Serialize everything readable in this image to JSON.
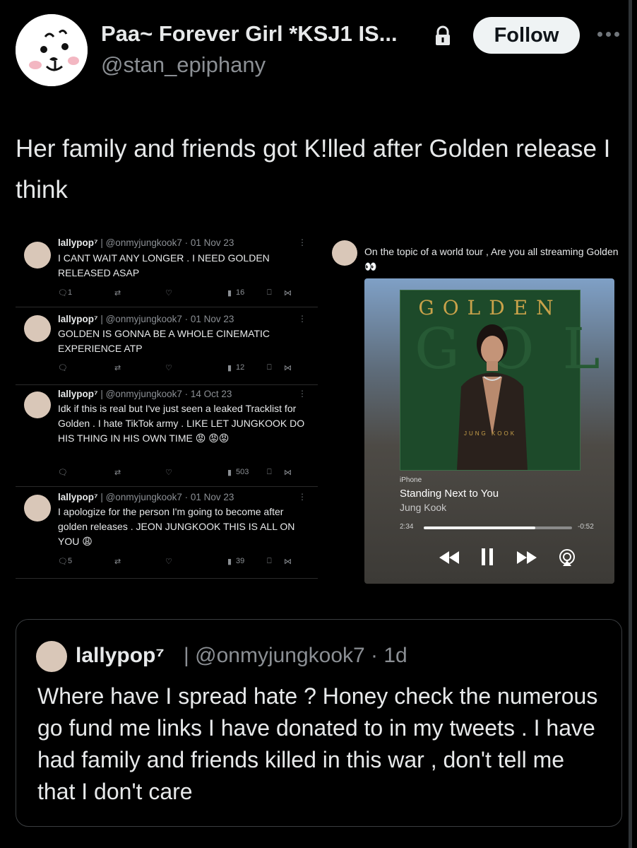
{
  "header": {
    "display_name": "Paa~ Forever Girl *KSJ1 IS...",
    "handle": "@stan_epiphany",
    "follow_label": "Follow"
  },
  "tweet": {
    "text": "Her family and friends got K!lled after Golden release I think"
  },
  "left_image": {
    "tweets": [
      {
        "name": "lallypop⁷",
        "handle": "| @onmyjungkook7 · 01 Nov 23",
        "body": "I CANT WAIT ANY LONGER . I NEED GOLDEN RELEASED ASAP",
        "replies": "1",
        "views": "16"
      },
      {
        "name": "lallypop⁷",
        "handle": "| @onmyjungkook7 · 01 Nov 23",
        "body": "GOLDEN IS GONNA BE A WHOLE CINEMATIC EXPERIENCE ATP",
        "replies": "",
        "views": "12"
      },
      {
        "name": "lallypop⁷",
        "handle": "| @onmyjungkook7 · 14 Oct 23",
        "body": "Idk if this is real but I've just seen a leaked Tracklist for Golden . I hate TikTok army . LIKE LET JUNGKOOK DO HIS THING IN HIS OWN TIME 😡 😡😡",
        "replies": "",
        "views": "503"
      },
      {
        "name": "lallypop⁷",
        "handle": "| @onmyjungkook7 · 01 Nov 23",
        "body": "I apologize for the person I'm going to become after golden releases . JEON JUNGKOOK THIS IS ALL ON YOU 😩",
        "replies": "5",
        "views": "39"
      }
    ]
  },
  "right_image": {
    "caption": "On the topic of a world tour , Are you all streaming Golden 👀",
    "album_title": "GOLDEN",
    "album_bg": "GOLDEN",
    "album_artist": "JUNG KOOK",
    "device": "iPhone",
    "song": "Standing Next to You",
    "artist": "Jung Kook",
    "elapsed": "2:34",
    "remaining": "-0:52",
    "progress": 0.75
  },
  "quote": {
    "name": "lallypop⁷",
    "handle": "| @onmyjungkook7 · 1d",
    "text": "Where have I spread hate ? Honey check the numerous go fund me links I have donated to in my tweets . I have had family and friends killed in this war , don't tell me that I don't care"
  }
}
